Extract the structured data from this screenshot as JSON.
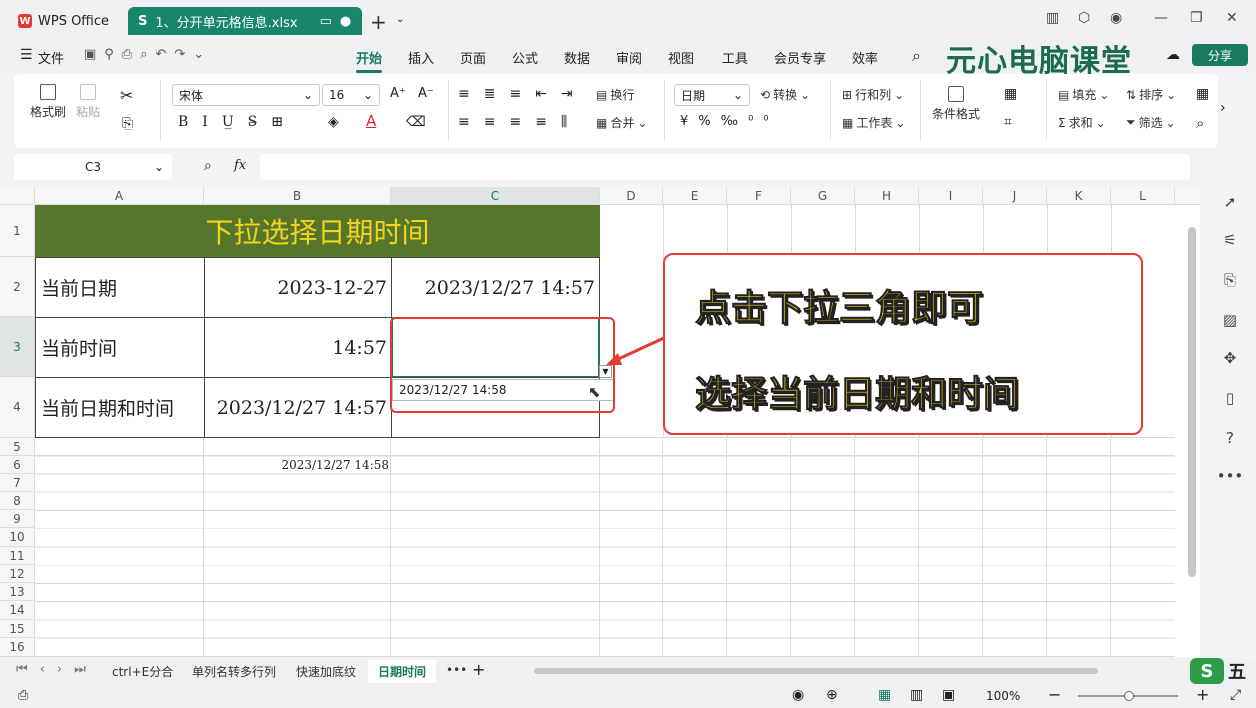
{
  "titlebar": {
    "app_tab": "WPS Office",
    "doc_tab": "1、分开单元格信息.xlsx",
    "doc_tab_letter": "S"
  },
  "menu": {
    "items": [
      "文件",
      "开始",
      "插入",
      "页面",
      "公式",
      "数据",
      "审阅",
      "视图",
      "工具",
      "会员专享",
      "效率"
    ],
    "active": "开始",
    "brand": "元心电脑课堂",
    "share": "分享"
  },
  "ribbon": {
    "format_painter": "格式刷",
    "paste": "粘贴",
    "font": "宋体",
    "font_size": "16",
    "wrap": "换行",
    "merge": "合并",
    "number_format": "日期",
    "convert": "转换",
    "rows_cols": "行和列",
    "worksheet": "工作表",
    "cond_format": "条件格式",
    "fill": "填充",
    "sort": "排序",
    "sum": "求和",
    "filter": "筛选"
  },
  "formula_bar": {
    "name_box": "C3",
    "fx": "fx"
  },
  "columns": [
    "A",
    "B",
    "C",
    "D",
    "E",
    "F",
    "G",
    "H",
    "I",
    "J",
    "K",
    "L"
  ],
  "rows": [
    "1",
    "2",
    "3",
    "4",
    "5",
    "6",
    "7",
    "8",
    "9",
    "10",
    "11",
    "12",
    "13",
    "14",
    "15",
    "16"
  ],
  "cells": {
    "title": "下拉选择日期时间",
    "A2": "当前日期",
    "B2": "2023-12-27",
    "C2": "2023/12/27 14:57",
    "A3": "当前时间",
    "B3": "14:57",
    "A4": "当前日期和时间",
    "B4": "2023/12/27 14:57",
    "B6": "2023/12/27 14:58"
  },
  "dropdown": {
    "option": "2023/12/27 14:58"
  },
  "callout": {
    "line1": "点击下拉三角即可",
    "line2": "选择当前日期和时间"
  },
  "sheets": {
    "tabs": [
      "ctrl+E分合",
      "单列名转多行列",
      "快速加底纹",
      "日期时间"
    ],
    "active": "日期时间",
    "more": "•••"
  },
  "status": {
    "zoom": "100%"
  },
  "colors": {
    "accent": "#1a7a5f",
    "title_bg": "#55762b",
    "title_fg": "#f5d31d",
    "callout_border": "#e53935"
  }
}
